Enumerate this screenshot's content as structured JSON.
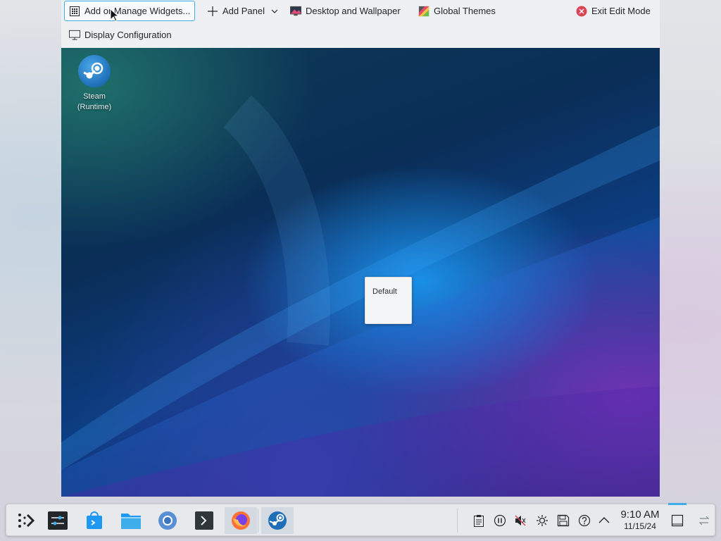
{
  "toolbar": {
    "widgets_label": "Add or Manage Widgets...",
    "add_panel_label": "Add Panel",
    "wallpaper_label": "Desktop and Wallpaper",
    "themes_label": "Global Themes",
    "exit_label": "Exit Edit Mode",
    "display_label": "Display Configuration"
  },
  "desktop": {
    "icon": {
      "label_line1": "Steam",
      "label_line2": "(Runtime)",
      "icon": "steam-icon"
    },
    "tile_label": "Default"
  },
  "taskbar": {
    "launchers": [
      {
        "name": "app-launcher",
        "icon": "kde-launcher-icon"
      },
      {
        "name": "system-settings",
        "icon": "settings-sliders-icon"
      },
      {
        "name": "discover",
        "icon": "discover-store-icon"
      },
      {
        "name": "dolphin",
        "icon": "folder-icon"
      },
      {
        "name": "chromium",
        "icon": "chrome-icon"
      },
      {
        "name": "konsole",
        "icon": "terminal-icon"
      },
      {
        "name": "firefox",
        "icon": "firefox-icon"
      },
      {
        "name": "steam",
        "icon": "steam-icon"
      }
    ],
    "tray_icons": [
      "clipboard-icon",
      "media-pause-icon",
      "volume-muted-icon",
      "brightness-icon",
      "save-icon",
      "help-icon",
      "chevron-up-icon"
    ],
    "clock": {
      "time": "9:10 AM",
      "date": "11/15/24"
    }
  },
  "colors": {
    "accent": "#3daee9",
    "exit_red": "#da4453"
  }
}
